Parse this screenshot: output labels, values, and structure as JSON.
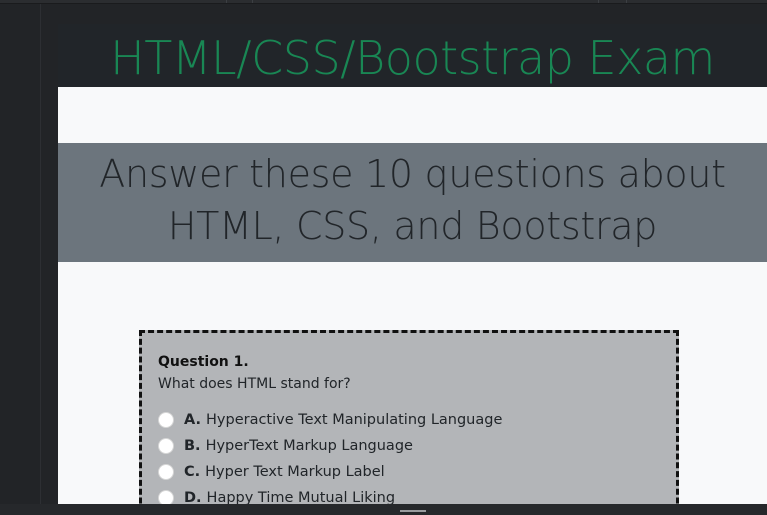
{
  "header": {
    "title": "HTML/CSS/Bootstrap Exam"
  },
  "banner": {
    "line1": "Answer these 10 questions about",
    "line2": "HTML, CSS, and Bootstrap"
  },
  "question": {
    "heading": "Question 1.",
    "prompt": "What does HTML stand for?",
    "options": [
      {
        "letter": "A.",
        "text": "Hyperactive Text Manipulating Language"
      },
      {
        "letter": "B.",
        "text": "HyperText Markup Language"
      },
      {
        "letter": "C.",
        "text": "Hyper Text Markup Label"
      },
      {
        "letter": "D.",
        "text": "Happy Time Mutual Liking"
      }
    ]
  },
  "colors": {
    "header_bg": "#212529",
    "title_text": "#198754",
    "banner_bg": "#6c757d",
    "card_bg": "#b3b5b8",
    "page_bg": "#f8f9fa"
  }
}
